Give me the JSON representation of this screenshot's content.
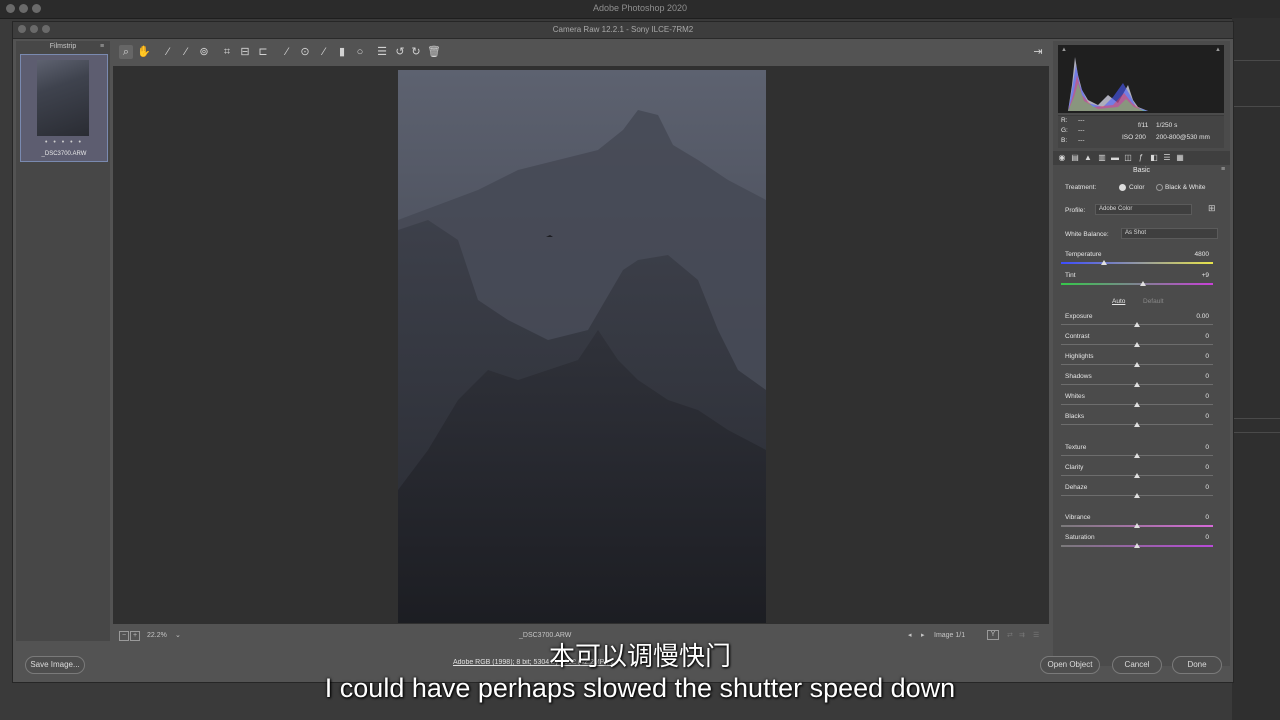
{
  "app": {
    "title": "Adobe Photoshop 2020"
  },
  "dialog": {
    "title": "Camera Raw 12.2.1  -  Sony ILCE-7RM2"
  },
  "filmstrip": {
    "header": "Filmstrip",
    "items": [
      {
        "rating": "• • • • •",
        "filename": "_DSC3700.ARW"
      }
    ]
  },
  "toolbar": {
    "tools": [
      "zoom-tool",
      "hand-tool",
      "white-balance-tool",
      "color-sampler-tool",
      "targeted-adjustment-tool",
      "crop-tool",
      "straighten-tool",
      "transform-tool",
      "spot-removal-tool",
      "red-eye-tool",
      "adjustment-brush-tool",
      "graduated-filter-tool",
      "radial-filter-tool",
      "preferences-tool",
      "rotate-left-tool",
      "rotate-right-tool",
      "trash-tool"
    ]
  },
  "preview": {
    "zoom": "22.2%",
    "filename": "_DSC3700.ARW",
    "image_counter": "Image 1/1",
    "compare_label": "Y"
  },
  "info": {
    "r_label": "R:",
    "g_label": "G:",
    "b_label": "B:",
    "r_value": "---",
    "g_value": "---",
    "b_value": "---",
    "aperture": "f/11",
    "shutter": "1/250 s",
    "iso": "ISO 200",
    "lens": "200-800@530 mm"
  },
  "panel": {
    "title": "Basic",
    "treatment_label": "Treatment:",
    "treatment_options": [
      "Color",
      "Black & White"
    ],
    "treatment_selected": "Color",
    "profile_label": "Profile:",
    "profile_value": "Adobe Color",
    "wb_label": "White Balance:",
    "wb_value": "As Shot",
    "auto_label": "Auto",
    "default_label": "Default",
    "sliders": [
      {
        "label": "Temperature",
        "value": "4800",
        "level": 0.28
      },
      {
        "label": "Tint",
        "value": "+9",
        "level": 0.54
      },
      {
        "label": "Exposure",
        "value": "0.00",
        "level": 0.5
      },
      {
        "label": "Contrast",
        "value": "0",
        "level": 0.5
      },
      {
        "label": "Highlights",
        "value": "0",
        "level": 0.5
      },
      {
        "label": "Shadows",
        "value": "0",
        "level": 0.5
      },
      {
        "label": "Whites",
        "value": "0",
        "level": 0.5
      },
      {
        "label": "Blacks",
        "value": "0",
        "level": 0.5
      },
      {
        "label": "Texture",
        "value": "0",
        "level": 0.5
      },
      {
        "label": "Clarity",
        "value": "0",
        "level": 0.5
      },
      {
        "label": "Dehaze",
        "value": "0",
        "level": 0.5
      },
      {
        "label": "Vibrance",
        "value": "0",
        "level": 0.5
      },
      {
        "label": "Saturation",
        "value": "0",
        "level": 0.5
      }
    ]
  },
  "footer": {
    "save_label": "Save Image...",
    "workflow_link": "Adobe RGB (1998); 8 bit; 5304 by 7952 (42.2MP); 240 ppi",
    "open_label": "Open Object",
    "cancel_label": "Cancel",
    "done_label": "Done"
  },
  "subtitles": {
    "chinese": "本可以调慢快门",
    "english": "I could have perhaps slowed the shutter speed down"
  },
  "colors": {
    "accent": "#7a8ab0",
    "background": "#535353",
    "panel": "#4b4b4b"
  }
}
